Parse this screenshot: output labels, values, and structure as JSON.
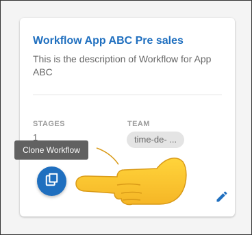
{
  "card": {
    "title": "Workflow App ABC Pre sales",
    "description": "This is the description of Workflow for App ABC",
    "stages_label": "STAGES",
    "stages_value": "1",
    "team_label": "TEAM",
    "team_chip": "time-de- ..."
  },
  "tooltip": {
    "text": "Clone Workflow"
  },
  "actions": {
    "clone_icon": "clone-icon",
    "edit_icon": "pencil-icon"
  },
  "overlay": {
    "pointer_icon": "pointing-hand-icon"
  },
  "colors": {
    "accent": "#1f6fbf",
    "tooltip_bg": "#616161",
    "chip_bg": "#e4e4e4",
    "hand": "#f7c531"
  }
}
